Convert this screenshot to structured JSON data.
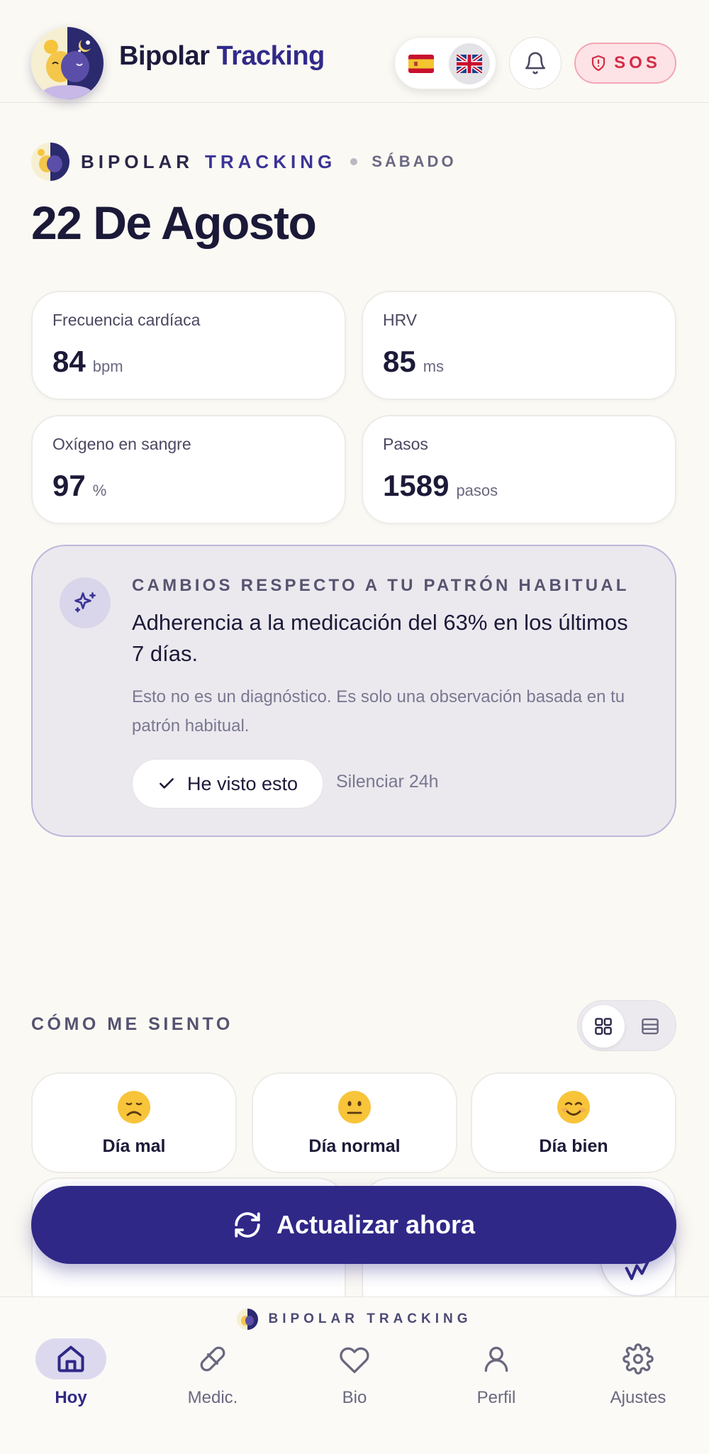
{
  "header": {
    "title_part1": "Bipolar",
    "title_part2": "Tracking",
    "languages": [
      {
        "code": "es",
        "flag": "🇪🇸",
        "selected": false
      },
      {
        "code": "en",
        "flag": "🇬🇧",
        "selected": true
      }
    ],
    "notifications_icon": "bell-icon",
    "sos_label": "SOS"
  },
  "heading": {
    "brand1": "BIPOLAR",
    "brand2": "TRACKING",
    "weekday": "SÁBADO",
    "date": "22 De Agosto"
  },
  "metrics": [
    {
      "label": "Frecuencia cardíaca",
      "value": "84",
      "unit": "bpm"
    },
    {
      "label": "HRV",
      "value": "85",
      "unit": "ms"
    },
    {
      "label": "Oxígeno en sangre",
      "value": "97",
      "unit": "%"
    },
    {
      "label": "Pasos",
      "value": "1589",
      "unit": "pasos"
    }
  ],
  "insight": {
    "kicker": "CAMBIOS RESPECTO A TU PATRÓN HABITUAL",
    "title": "Adherencia a la medicación del 63% en los últimos 7 días.",
    "note": "Esto no es un diagnóstico. Es solo una observación basada en tu patrón habitual.",
    "seen_label": "He visto esto",
    "mute_label": "Silenciar 24h"
  },
  "mood": {
    "title": "CÓMO ME SIENTO",
    "options": [
      {
        "emoji": "😞",
        "label": "Día mal"
      },
      {
        "emoji": "😐",
        "label": "Día normal"
      },
      {
        "emoji": "😊",
        "label": "Día bien"
      }
    ]
  },
  "refresh_label": "Actualizar ahora",
  "nav": {
    "brand": "BIPOLAR TRACKING",
    "items": [
      {
        "label": "Hoy",
        "icon": "home-icon",
        "active": true
      },
      {
        "label": "Medic.",
        "icon": "pill-icon",
        "active": false
      },
      {
        "label": "Bio",
        "icon": "heart-icon",
        "active": false
      },
      {
        "label": "Perfil",
        "icon": "user-icon",
        "active": false
      },
      {
        "label": "Ajustes",
        "icon": "gear-icon",
        "active": false
      }
    ]
  },
  "colors": {
    "background": "#fbf9f3",
    "primary": "#2f2887",
    "sos": "#d52d47",
    "insight_bg": "#ebe9ee"
  }
}
